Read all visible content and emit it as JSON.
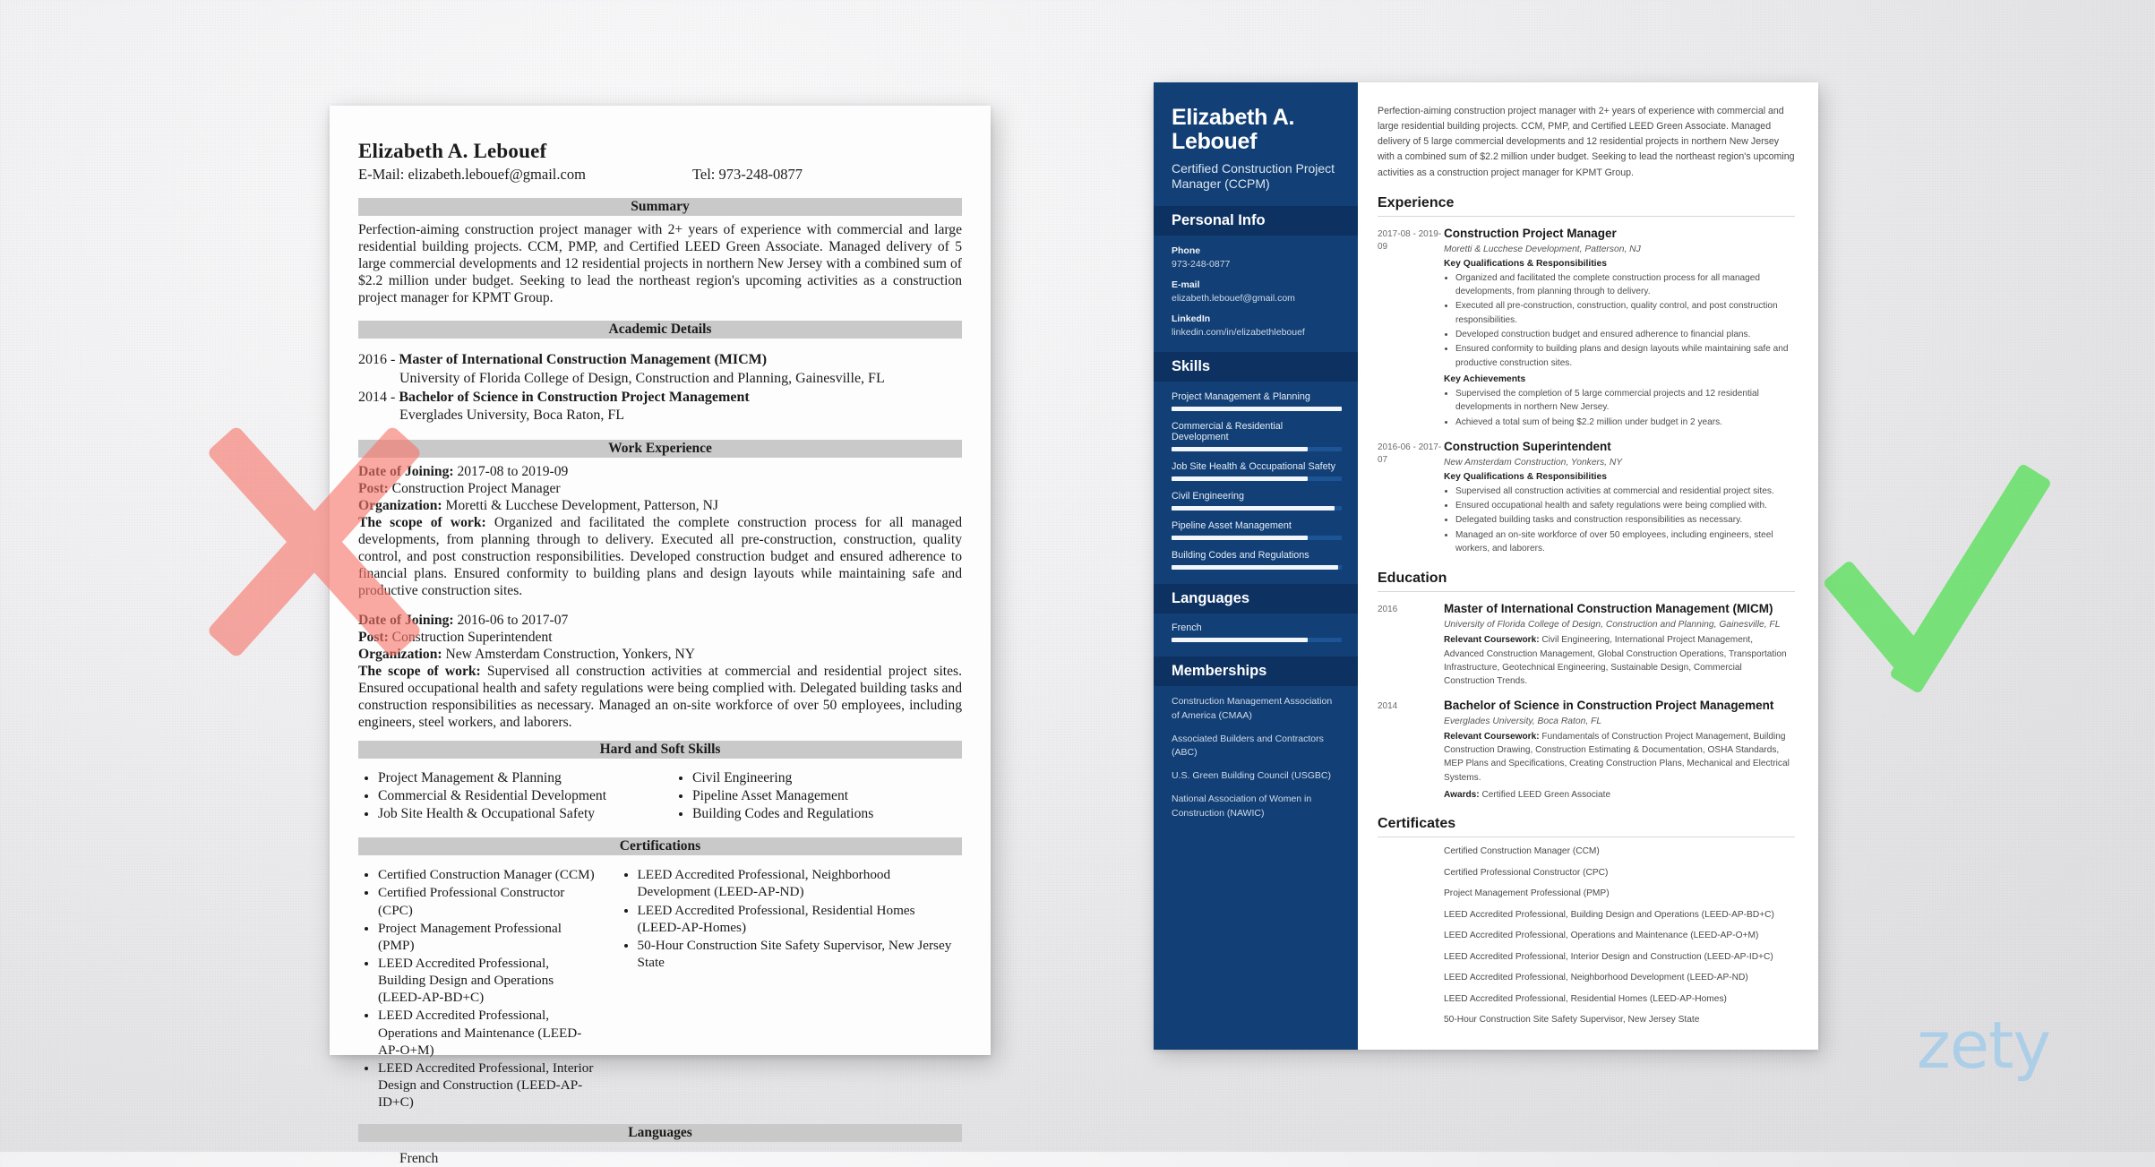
{
  "brand": {
    "logo_text": "zety",
    "logo_color": "#a8cde8"
  },
  "marks": {
    "bad_mark": "x-mark",
    "good_mark": "check-mark",
    "bad_color": "#f8766b",
    "good_color": "#5ae05a"
  },
  "left_resume": {
    "name": "Elizabeth A. Lebouef",
    "email_line": "E-Mail: elizabeth.lebouef@gmail.com",
    "tel_line": "Tel: 973-248-0877",
    "sections": {
      "summary_heading": "Summary",
      "summary_text": "Perfection-aiming construction project manager with 2+ years of experience with commercial and large residential building projects. CCM, PMP, and Certified LEED Green Associate. Managed delivery of 5 large commercial developments and 12 residential projects in northern New Jersey with a combined sum of $2.2 million under budget. Seeking to lead the northeast region's upcoming activities as a construction project manager for KPMT Group.",
      "academic_heading": "Academic Details",
      "education": [
        {
          "year": "2016 - ",
          "degree": "Master of International Construction Management (MICM)",
          "school": "University of Florida College of Design, Construction and Planning, Gainesville, FL"
        },
        {
          "year": "2014 - ",
          "degree": "Bachelor of Science in Construction Project Management",
          "school": "Everglades University, Boca Raton, FL"
        }
      ],
      "work_heading": "Work Experience",
      "jobs": [
        {
          "date_label": "Date of Joining:",
          "date_value": " 2017-08 to 2019-09",
          "post_label": "Post:",
          "post_value": " Construction Project Manager",
          "org_label": "Organization:",
          "org_value": " Moretti & Lucchese Development, Patterson, NJ",
          "scope_label": "The scope of work:",
          "scope_value": " Organized and facilitated the complete construction process for all managed developments, from planning through to delivery. Executed all pre-construction, construction, quality control, and post construction responsibilities. Developed construction budget and ensured adherence to financial plans. Ensured conformity to building plans and design layouts while maintaining safe and productive construction sites."
        },
        {
          "date_label": "Date of Joining:",
          "date_value": " 2016-06 to 2017-07",
          "post_label": "Post:",
          "post_value": " Construction Superintendent",
          "org_label": "Organization:",
          "org_value": " New Amsterdam Construction, Yonkers, NY",
          "scope_label": "The scope of work:",
          "scope_value": " Supervised all construction activities at commercial and residential project sites. Ensured occupational health and safety regulations were being complied with. Delegated building tasks and construction responsibilities as necessary. Managed an on-site workforce of over 50 employees, including engineers, steel workers, and laborers."
        }
      ],
      "skills_heading": "Hard and Soft Skills",
      "skills_col1": [
        "Project Management & Planning",
        "Commercial & Residential Development",
        "Job Site Health & Occupational Safety"
      ],
      "skills_col2": [
        "Civil Engineering",
        "Pipeline Asset Management",
        "Building Codes and Regulations"
      ],
      "certifications_heading": "Certifications",
      "certs_col1": [
        "Certified Construction Manager (CCM)",
        "Certified Professional Constructor (CPC)",
        "Project Management Professional (PMP)",
        "LEED Accredited Professional, Building Design and Operations (LEED-AP-BD+C)",
        "LEED Accredited Professional, Operations and Maintenance (LEED-AP-O+M)",
        "LEED Accredited Professional, Interior Design and Construction (LEED-AP-ID+C)"
      ],
      "certs_col2": [
        "LEED Accredited Professional, Neighborhood Development (LEED-AP-ND)",
        "LEED Accredited Professional, Residential Homes (LEED-AP-Homes)",
        "50-Hour Construction Site Safety Supervisor, New Jersey State"
      ],
      "languages_heading": "Languages",
      "languages": "French"
    }
  },
  "right_resume": {
    "sidebar": {
      "name": "Elizabeth A. Lebouef",
      "title": "Certified Construction Project Manager (CCPM)",
      "personal_info_heading": "Personal Info",
      "phone_label": "Phone",
      "phone_value": "973-248-0877",
      "email_label": "E-mail",
      "email_value": "elizabeth.lebouef@gmail.com",
      "linkedin_label": "LinkedIn",
      "linkedin_value": "linkedin.com/in/elizabethlebouef",
      "skills_heading": "Skills",
      "skills": [
        {
          "name": "Project Management & Planning",
          "level": 100
        },
        {
          "name": "Commercial & Residential Development",
          "level": 80
        },
        {
          "name": "Job Site Health & Occupational Safety",
          "level": 80
        },
        {
          "name": "Civil Engineering",
          "level": 96
        },
        {
          "name": "Pipeline Asset Management",
          "level": 80
        },
        {
          "name": "Building Codes and Regulations",
          "level": 98
        }
      ],
      "languages_heading": "Languages",
      "languages": [
        {
          "name": "French",
          "level": 80
        }
      ],
      "memberships_heading": "Memberships",
      "memberships": [
        "Construction Management Association of America (CMAA)",
        "Associated Builders and Contractors (ABC)",
        "U.S. Green Building Council (USGBC)",
        "National Association of Women in Construction (NAWIC)"
      ]
    },
    "main": {
      "summary": "Perfection-aiming construction project manager with 2+ years of experience with commercial and large residential building projects. CCM, PMP, and Certified LEED Green Associate. Managed delivery of 5 large commercial developments and 12 residential projects in northern New Jersey with a combined sum of $2.2 million under budget. Seeking to lead the northeast region's upcoming activities as a construction project manager for KPMT Group.",
      "experience_heading": "Experience",
      "experience": [
        {
          "date": "2017-08 - 2019-09",
          "role": "Construction Project Manager",
          "org": "Moretti & Lucchese Development, Patterson, NJ",
          "quals_label": "Key Qualifications & Responsibilities",
          "quals": [
            "Organized and facilitated the complete construction process for all managed developments, from planning through to delivery.",
            "Executed all pre-construction, construction, quality control, and post construction responsibilities.",
            "Developed construction budget and ensured adherence to financial plans.",
            "Ensured conformity to building plans and design layouts while maintaining safe and productive construction sites."
          ],
          "achievements_label": "Key Achievements",
          "achievements": [
            "Supervised the completion of 5 large commercial projects and 12 residential developments in northern New Jersey.",
            "Achieved a total sum of being $2.2 million under budget in 2 years."
          ]
        },
        {
          "date": "2016-06 - 2017-07",
          "role": "Construction Superintendent",
          "org": "New Amsterdam Construction, Yonkers, NY",
          "quals_label": "Key Qualifications & Responsibilities",
          "quals": [
            "Supervised all construction activities at commercial and residential project sites.",
            "Ensured occupational health and safety regulations were being complied with.",
            "Delegated building tasks and construction responsibilities as necessary.",
            "Managed an on-site workforce of over 50 employees, including engineers, steel workers, and laborers."
          ],
          "achievements_label": "",
          "achievements": []
        }
      ],
      "education_heading": "Education",
      "education": [
        {
          "date": "2016",
          "degree": "Master of International Construction Management (MICM)",
          "school": "University of Florida College of Design, Construction and Planning, Gainesville, FL",
          "coursework_label": "Relevant Coursework:",
          "coursework": " Civil Engineering, International Project Management, Advanced Construction Management, Global Construction Operations, Transportation Infrastructure, Geotechnical Engineering, Sustainable Design, Commercial Construction Trends.",
          "awards_label": "",
          "awards": ""
        },
        {
          "date": "2014",
          "degree": "Bachelor of Science in Construction Project Management",
          "school": "Everglades University, Boca Raton, FL",
          "coursework_label": "Relevant Coursework:",
          "coursework": " Fundamentals of Construction Project Management, Building Construction Drawing, Construction Estimating & Documentation, OSHA Standards, MEP Plans and Specifications, Creating Construction Plans, Mechanical and Electrical Systems.",
          "awards_label": "Awards:",
          "awards": " Certified LEED Green Associate"
        }
      ],
      "certificates_heading": "Certificates",
      "certificates": [
        "Certified Construction Manager (CCM)",
        "Certified Professional Constructor (CPC)",
        "Project Management Professional (PMP)",
        "LEED Accredited Professional, Building Design and Operations (LEED-AP-BD+C)",
        "LEED Accredited Professional, Operations and Maintenance (LEED-AP-O+M)",
        "LEED Accredited Professional, Interior Design and Construction (LEED-AP-ID+C)",
        "LEED Accredited Professional, Neighborhood Development (LEED-AP-ND)",
        "LEED Accredited Professional, Residential Homes (LEED-AP-Homes)",
        "50-Hour Construction Site Safety Supervisor, New Jersey State"
      ]
    }
  }
}
